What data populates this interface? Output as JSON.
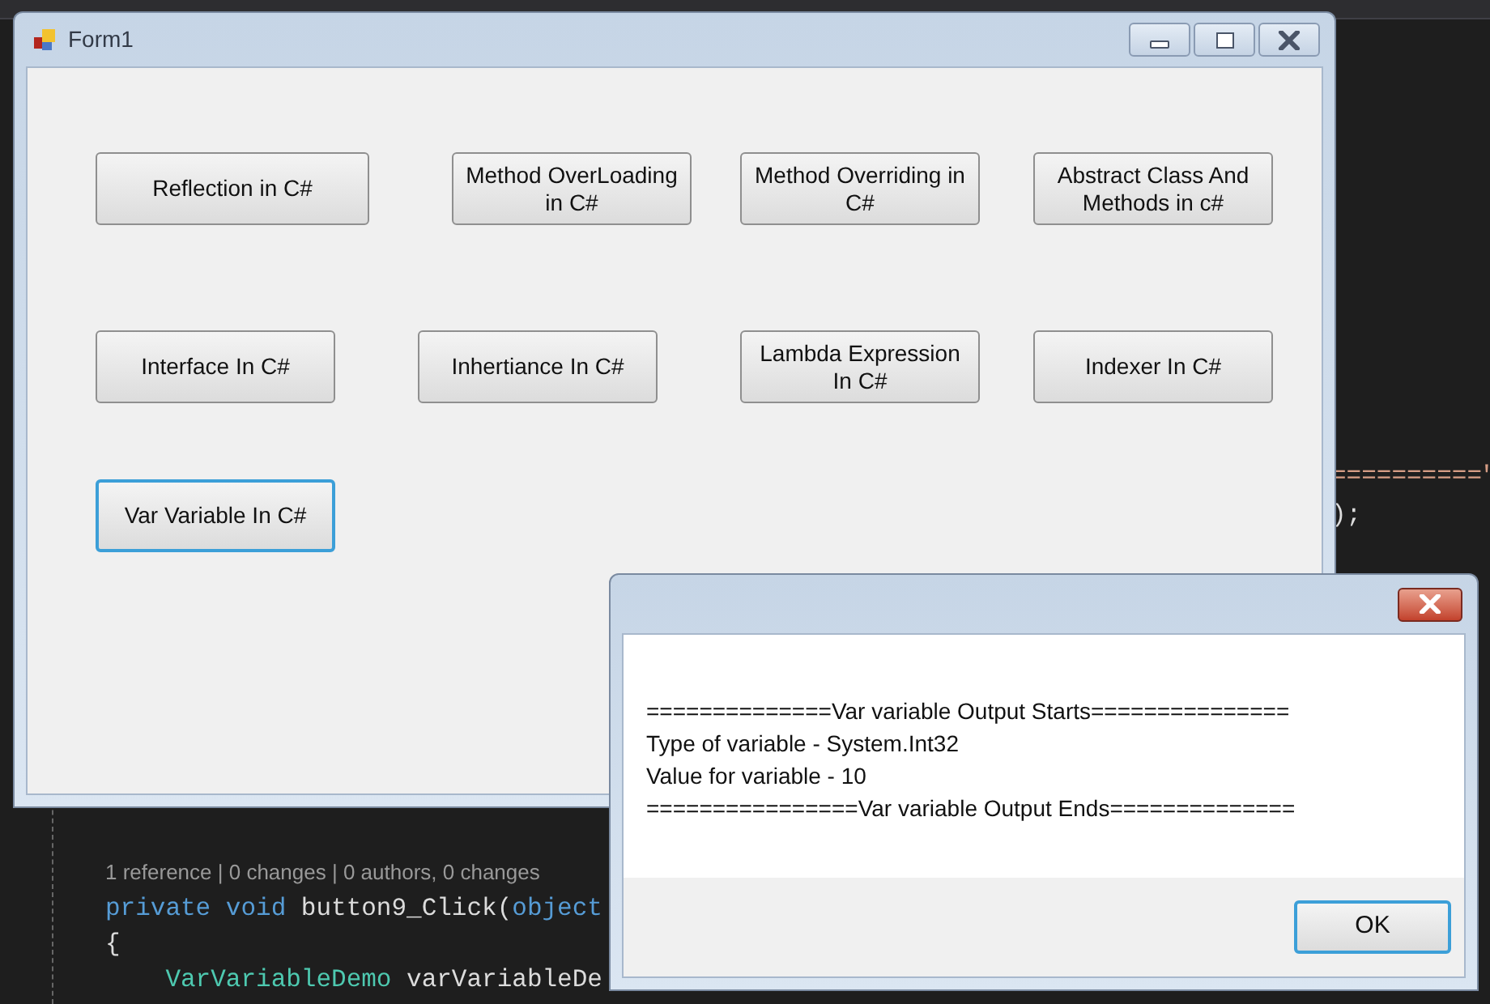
{
  "editor": {
    "side_lines": [
      {
        "kind": "string",
        "text": "==========\""
      },
      {
        "kind": "plain",
        "text": ");"
      }
    ],
    "lines": [
      {
        "kind": "lens",
        "segments": [
          {
            "kind": "lens",
            "text": "1 reference | 0 changes | 0 authors, 0 changes"
          }
        ]
      },
      {
        "kind": "code",
        "segments": [
          {
            "kind": "keyword",
            "text": "private void "
          },
          {
            "kind": "plain",
            "text": "button9_Click("
          },
          {
            "kind": "keyword",
            "text": "object"
          }
        ]
      },
      {
        "kind": "code",
        "segments": [
          {
            "kind": "plain",
            "text": "{"
          }
        ]
      },
      {
        "kind": "code",
        "segments": [
          {
            "kind": "type",
            "text": "    VarVariableDemo "
          },
          {
            "kind": "plain",
            "text": "varVariableDe"
          }
        ]
      }
    ]
  },
  "form": {
    "title": "Form1",
    "buttons": [
      {
        "label": "Reflection in C#",
        "focused": false
      },
      {
        "label": "Method OverLoading in C#",
        "focused": false
      },
      {
        "label": "Method Overriding in C#",
        "focused": false
      },
      {
        "label": "Abstract Class And Methods in c#",
        "focused": false
      },
      {
        "label": "Interface In C#",
        "focused": false
      },
      {
        "label": "Inhertiance In C#",
        "focused": false
      },
      {
        "label": "Lambda Expression In C#",
        "focused": false
      },
      {
        "label": "Indexer In C#",
        "focused": false
      },
      {
        "label": "Var Variable In C#",
        "focused": true
      }
    ]
  },
  "message_box": {
    "lines": [
      "==============Var variable Output Starts===============",
      "Type of variable - System.Int32",
      "Value for variable - 10",
      "================Var variable Output Ends=============="
    ],
    "ok_button": "OK"
  }
}
